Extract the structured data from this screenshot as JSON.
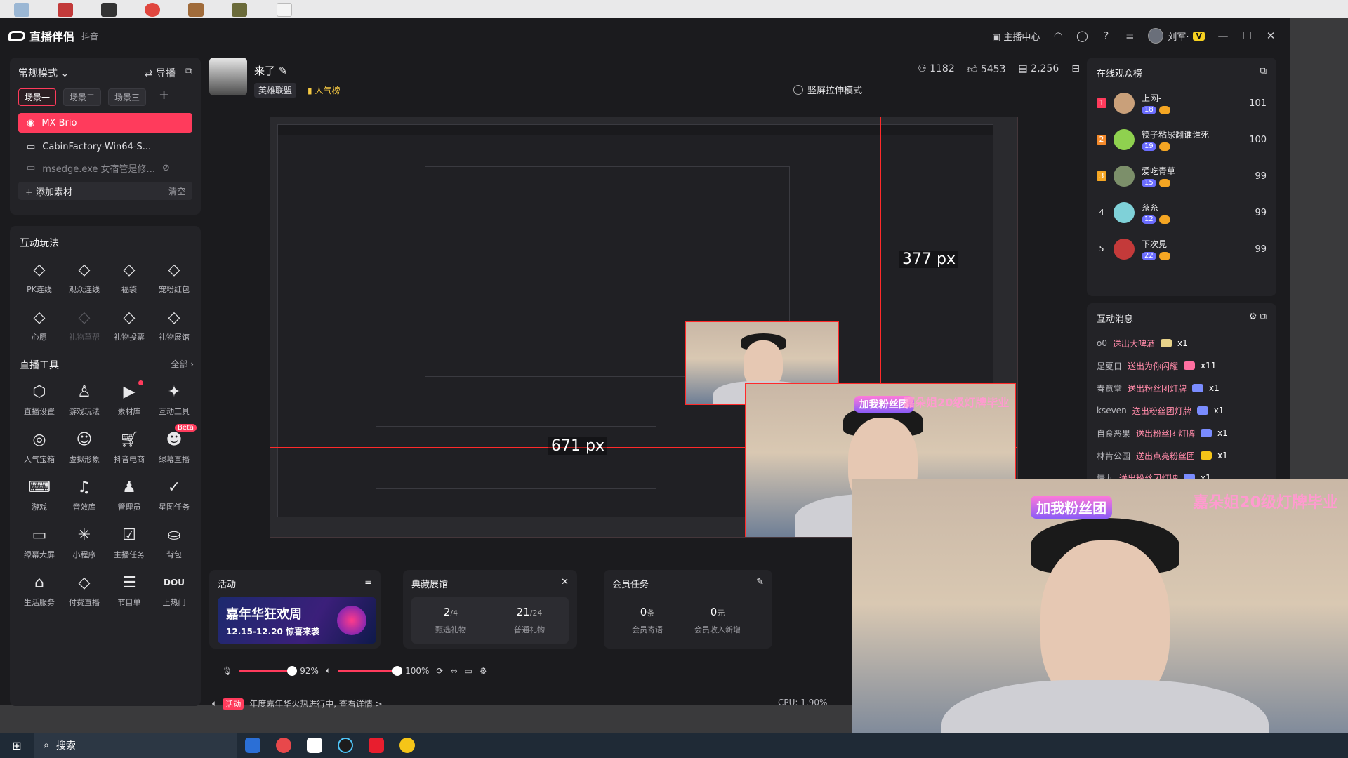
{
  "app": {
    "name": "直播伴侣",
    "platform": "抖音",
    "titlebar": {
      "host_center": "主播中心",
      "user_name": "刘军·",
      "user_badge": "V"
    }
  },
  "sidebar": {
    "mode_label": "常规模式",
    "guide_label": "导播",
    "scenes": [
      "场景一",
      "场景二",
      "场景三"
    ],
    "sources": [
      {
        "label": "MX Brio"
      },
      {
        "label": "CabinFactory-Win64-S..."
      },
      {
        "label": "msedge.exe 女宿管是修..."
      }
    ],
    "add_material": "添加素材",
    "clear_label": "清空"
  },
  "interactive": {
    "title": "互动玩法",
    "items": [
      {
        "label": "PK连线",
        "icon": "pk-icon",
        "disabled": false
      },
      {
        "label": "观众连线",
        "icon": "audience-link-icon",
        "disabled": false
      },
      {
        "label": "福袋",
        "icon": "lucky-bag-icon",
        "disabled": false
      },
      {
        "label": "宠粉红包",
        "icon": "red-packet-icon",
        "disabled": false
      },
      {
        "label": "心愿",
        "icon": "wish-icon",
        "disabled": false
      },
      {
        "label": "礼物草帮",
        "icon": "gift-help-icon",
        "disabled": true
      },
      {
        "label": "礼物投票",
        "icon": "gift-vote-icon",
        "disabled": false
      },
      {
        "label": "礼物展馆",
        "icon": "gift-gallery-icon",
        "disabled": false
      }
    ]
  },
  "tools": {
    "title": "直播工具",
    "all_label": "全部",
    "items": [
      {
        "label": "直播设置",
        "icon": "settings-icon"
      },
      {
        "label": "游戏玩法",
        "icon": "game-play-icon"
      },
      {
        "label": "素材库",
        "icon": "material-library-icon",
        "dot": true
      },
      {
        "label": "互动工具",
        "icon": "interactive-tools-icon"
      },
      {
        "label": "人气宝箱",
        "icon": "popularity-box-icon"
      },
      {
        "label": "虚拟形象",
        "icon": "avatar-icon"
      },
      {
        "label": "抖音电商",
        "icon": "shopping-cart-icon"
      },
      {
        "label": "绿幕直播",
        "icon": "green-screen-icon",
        "beta": "Beta"
      },
      {
        "label": "游戏",
        "icon": "gamepad-icon"
      },
      {
        "label": "音效库",
        "icon": "sound-effect-icon"
      },
      {
        "label": "管理员",
        "icon": "admin-icon"
      },
      {
        "label": "星图任务",
        "icon": "star-task-icon"
      },
      {
        "label": "绿幕大屏",
        "icon": "green-big-screen-icon"
      },
      {
        "label": "小程序",
        "icon": "mini-program-icon"
      },
      {
        "label": "主播任务",
        "icon": "host-task-icon"
      },
      {
        "label": "背包",
        "icon": "backpack-icon"
      },
      {
        "label": "生活服务",
        "icon": "life-service-icon"
      },
      {
        "label": "付费直播",
        "icon": "paid-live-icon"
      },
      {
        "label": "节目单",
        "icon": "program-list-icon"
      },
      {
        "label": "上热门",
        "icon": "dou-plus-icon"
      }
    ]
  },
  "streamer": {
    "name": "来了",
    "tag_game": "英雄联盟",
    "tag_hot": "人气榜",
    "viewers": "1182",
    "likes": "5453",
    "coins": "2,256",
    "portrait_mode": "竖屏拉伸模式"
  },
  "preview": {
    "measure_h": "671 px",
    "measure_v": "377 px",
    "fan_badge": "加我粉丝团",
    "banner": "嘉朵姐20级灯牌毕业"
  },
  "panels": {
    "activity": {
      "title": "活动",
      "promo_title": "嘉年华狂欢周",
      "promo_sub": "12.15-12.20 惊喜来袭"
    },
    "gallery": {
      "title": "典藏展馆",
      "stat1_num": "2",
      "stat1_den": "/4",
      "stat1_cap": "甄选礼物",
      "stat2_num": "21",
      "stat2_den": "/24",
      "stat2_cap": "普通礼物"
    },
    "member": {
      "title": "会员任务",
      "stat1_num": "0",
      "stat1_unit": "条",
      "stat1_cap": "会员寄语",
      "stat2_num": "0",
      "stat2_unit": "元",
      "stat2_cap": "会员收入新增"
    }
  },
  "audio": {
    "mic_volume": "92%",
    "speaker_volume": "100%",
    "mic_level": 0.92,
    "speaker_level": 1.0
  },
  "notice": {
    "tag": "活动",
    "text": "年度嘉年华火热进行中, 查看详情 >"
  },
  "cpu": "CPU: 1.90%",
  "online": {
    "title": "在线观众榜",
    "viewers": [
      {
        "rank": "1",
        "name": "上网-",
        "level": "18",
        "score": "101"
      },
      {
        "rank": "2",
        "name": "筷子粘尿翻谁谁死",
        "level": "19",
        "score": "100"
      },
      {
        "rank": "3",
        "name": "爱吃青草",
        "level": "15",
        "score": "99"
      },
      {
        "rank": "4",
        "name": "糸糸",
        "level": "12",
        "score": "99"
      },
      {
        "rank": "5",
        "name": "下次見",
        "level": "22",
        "score": "99"
      }
    ]
  },
  "messages": {
    "title": "互动消息",
    "items": [
      {
        "user": "o0",
        "action": "送出大啤酒",
        "count": "x1"
      },
      {
        "user": "是夏日",
        "action": "送出为你闪耀",
        "count": "x11"
      },
      {
        "user": "春意堂",
        "action": "送出粉丝团灯牌",
        "count": "x1"
      },
      {
        "user": "kseven",
        "action": "送出粉丝团灯牌",
        "count": "x1"
      },
      {
        "user": "自食恶果",
        "action": "送出粉丝团灯牌",
        "count": "x1"
      },
      {
        "user": "林肯公园",
        "action": "送出点亮粉丝团",
        "count": "x1"
      },
      {
        "user": "情九",
        "action": "送出粉丝团灯牌",
        "count": "x1"
      }
    ]
  },
  "taskbar": {
    "search_placeholder": "搜索"
  }
}
